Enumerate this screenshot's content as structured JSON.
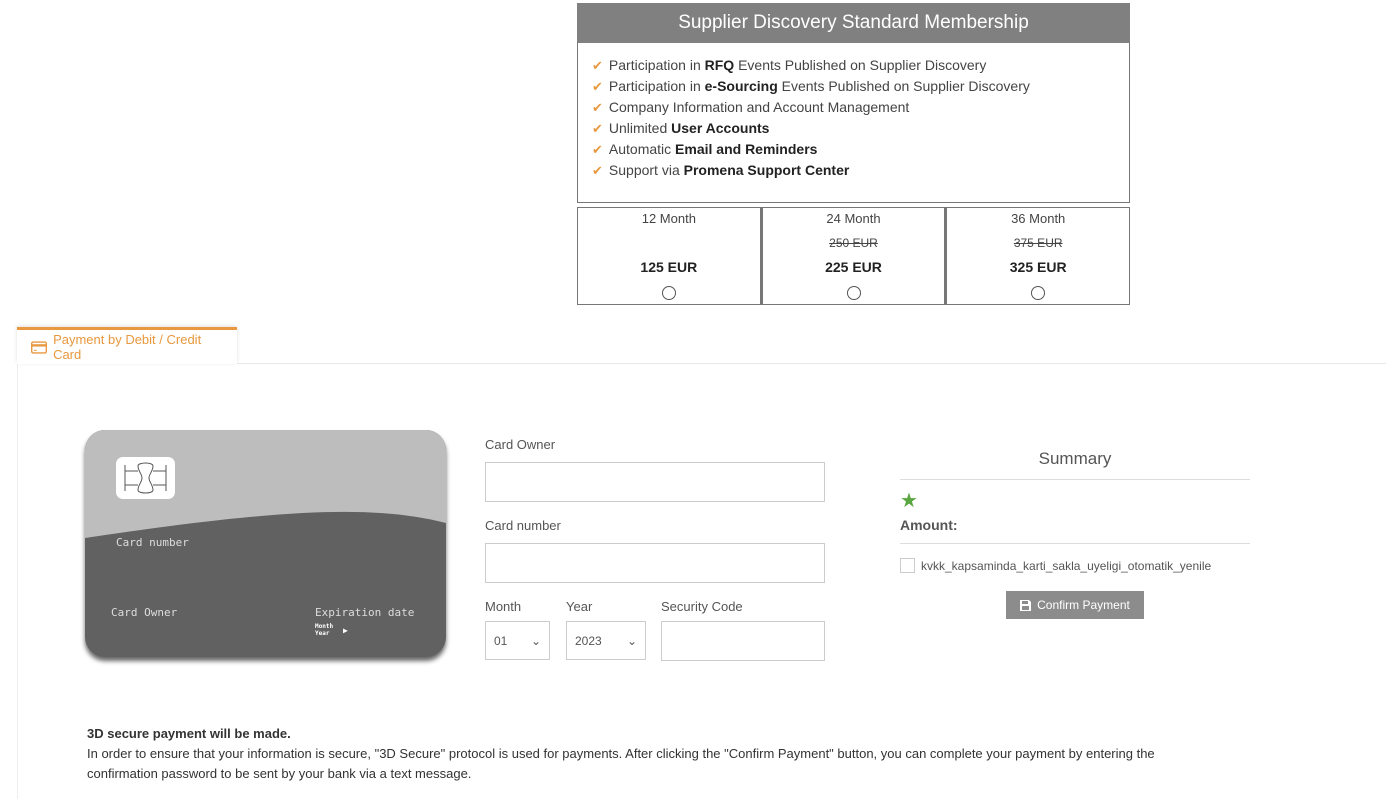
{
  "plan": {
    "title": "Supplier Discovery Standard Membership",
    "features": [
      {
        "pre": "Participation in ",
        "bold": "RFQ",
        "post": " Events Published on Supplier Discovery"
      },
      {
        "pre": "Participation in ",
        "bold": "e-Sourcing",
        "post": " Events Published on Supplier Discovery"
      },
      {
        "pre": "Company Information and Account Management",
        "bold": "",
        "post": ""
      },
      {
        "pre": "Unlimited ",
        "bold": "User Accounts",
        "post": ""
      },
      {
        "pre": "Automatic ",
        "bold": "Email and Reminders",
        "post": ""
      },
      {
        "pre": "Support via ",
        "bold": "Promena Support Center",
        "post": ""
      }
    ],
    "prices": [
      {
        "period": "12 Month",
        "old": "",
        "price": "125 EUR",
        "selected": false
      },
      {
        "period": "24 Month",
        "old": "250 EUR",
        "price": "225 EUR",
        "selected": false
      },
      {
        "period": "36 Month",
        "old": "375 EUR",
        "price": "325 EUR",
        "selected": false
      }
    ]
  },
  "tab": {
    "label": "Payment by Debit / Credit Card",
    "icon": "credit-card-icon",
    "color": "#e8983e"
  },
  "card": {
    "number_label": "Card number",
    "owner_label": "Card Owner",
    "exp_label": "Expiration date",
    "month": "Month",
    "year": "Year"
  },
  "form": {
    "owner_label": "Card Owner",
    "owner_value": "",
    "number_label": "Card number",
    "number_value": "",
    "month_label": "Month",
    "month_value": "01",
    "year_label": "Year",
    "year_value": "2023",
    "cvc_label": "Security Code",
    "cvc_value": ""
  },
  "summary": {
    "title": "Summary",
    "amount_label": "Amount:",
    "checkbox_label": "kvkk_kapsaminda_karti_sakla_uyeligi_otomatik_yenile",
    "checked": false,
    "confirm_label": "Confirm Payment",
    "star_color": "#5aa640"
  },
  "note": {
    "title": "3D secure payment will be made.",
    "text": "In order to ensure that your information is secure, \"3D Secure\" protocol is used for payments. After clicking the \"Confirm Payment\" button, you can complete your payment by entering the confirmation password to be sent by your bank via a text message."
  }
}
